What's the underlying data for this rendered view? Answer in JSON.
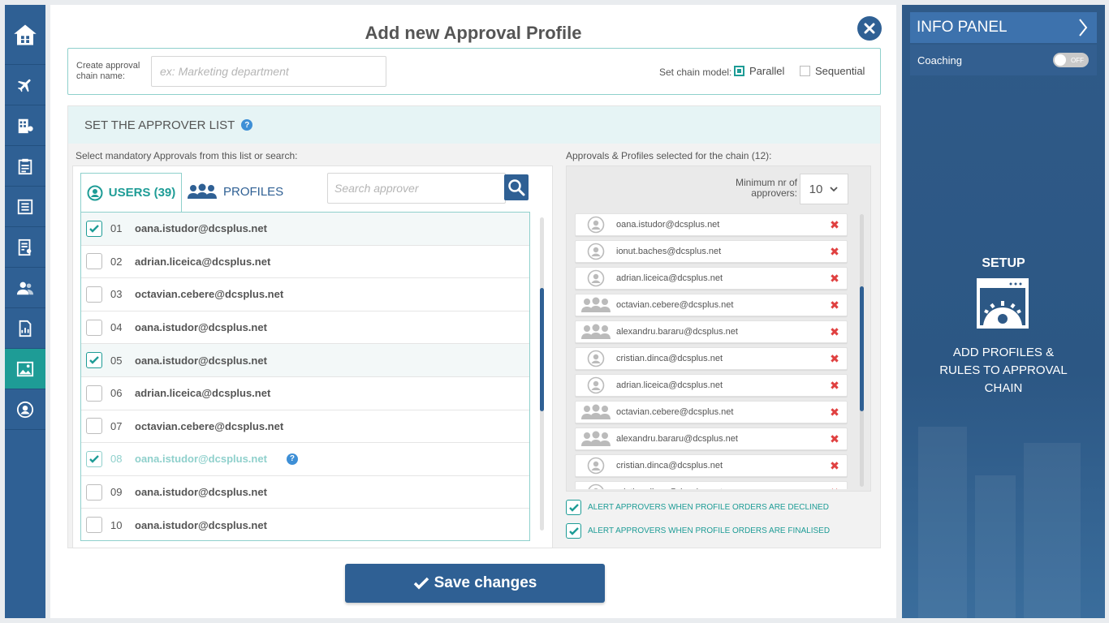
{
  "sidebar": {
    "items": [
      {
        "icon": "home-icon"
      },
      {
        "icon": "plane-icon"
      },
      {
        "icon": "hotel-icon"
      },
      {
        "icon": "checklist-icon"
      },
      {
        "icon": "document-icon"
      },
      {
        "icon": "report-icon"
      },
      {
        "icon": "users-icon"
      },
      {
        "icon": "chart-doc-icon"
      },
      {
        "icon": "image-settings-icon",
        "active": true
      },
      {
        "icon": "user-circle-icon"
      }
    ]
  },
  "dialog": {
    "title": "Add new Approval Profile",
    "chain_name_label": "Create approval chain name:",
    "chain_name_placeholder": "ex: Marketing department",
    "chain_model_label": "Set chain model:",
    "model_parallel": "Parallel",
    "model_sequential": "Sequential",
    "selected_model": "Parallel"
  },
  "approver": {
    "section_title": "SET THE APPROVER LIST",
    "left_label": "Select mandatory Approvals from this list or search:",
    "right_label": "Approvals & Profiles selected for the chain (12):",
    "tab_users": "USERS (39)",
    "tab_profiles": "PROFILES",
    "search_placeholder": "Search approver",
    "users": [
      {
        "num": "01",
        "email": "oana.istudor@dcsplus.net",
        "checked": true
      },
      {
        "num": "02",
        "email": "adrian.liceica@dcsplus.net",
        "checked": false
      },
      {
        "num": "03",
        "email": "octavian.cebere@dcsplus.net",
        "checked": false
      },
      {
        "num": "04",
        "email": "oana.istudor@dcsplus.net",
        "checked": false
      },
      {
        "num": "05",
        "email": "oana.istudor@dcsplus.net",
        "checked": true
      },
      {
        "num": "06",
        "email": "adrian.liceica@dcsplus.net",
        "checked": false
      },
      {
        "num": "07",
        "email": "octavian.cebere@dcsplus.net",
        "checked": false
      },
      {
        "num": "08",
        "email": "oana.istudor@dcsplus.net",
        "checked": true,
        "faded": true
      },
      {
        "num": "09",
        "email": "oana.istudor@dcsplus.net",
        "checked": false
      },
      {
        "num": "10",
        "email": "oana.istudor@dcsplus.net",
        "checked": false
      }
    ],
    "min_label": "Minimum nr of approvers:",
    "min_value": "10",
    "selected": [
      {
        "email": "oana.istudor@dcsplus.net",
        "type": "user"
      },
      {
        "email": "ionut.baches@dcsplus.net",
        "type": "user"
      },
      {
        "email": "adrian.liceica@dcsplus.net",
        "type": "user"
      },
      {
        "email": "octavian.cebere@dcsplus.net",
        "type": "group"
      },
      {
        "email": "alexandru.bararu@dcsplus.net",
        "type": "group"
      },
      {
        "email": "cristian.dinca@dcsplus.net",
        "type": "user"
      },
      {
        "email": "adrian.liceica@dcsplus.net",
        "type": "user"
      },
      {
        "email": "octavian.cebere@dcsplus.net",
        "type": "group"
      },
      {
        "email": "alexandru.bararu@dcsplus.net",
        "type": "group"
      },
      {
        "email": "cristian.dinca@dcsplus.net",
        "type": "user"
      },
      {
        "email": "cristian.dinca@dcsplus.net",
        "type": "user"
      }
    ],
    "alert_declined": "ALERT APPROVERS WHEN PROFILE ORDERS ARE DECLINED",
    "alert_finalised": "ALERT APPROVERS WHEN PROFILE ORDERS ARE FINALISED"
  },
  "save_label": "Save changes",
  "info_panel": {
    "title": "INFO PANEL",
    "coaching_label": "Coaching",
    "toggle_state": "OFF",
    "setup_title": "SETUP",
    "setup_text": "ADD PROFILES & RULES TO APPROVAL CHAIN"
  },
  "colors": {
    "brand": "#2f6094",
    "accent": "#1e9c96",
    "danger": "#e04040"
  }
}
